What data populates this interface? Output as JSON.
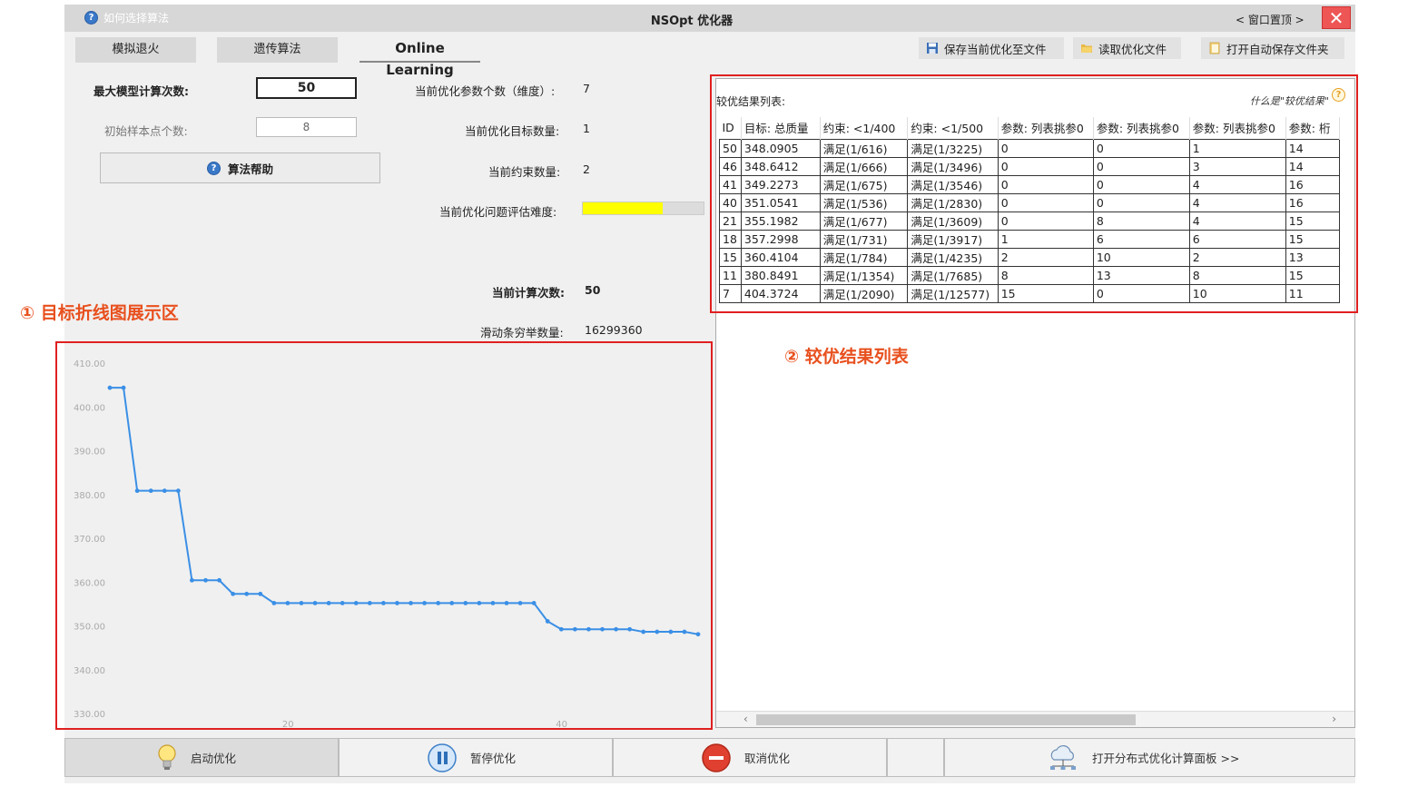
{
  "titlebar": {
    "help_label": "如何选择算法",
    "app_title": "NSOpt 优化器",
    "pin_label": "< 窗口置顶 >",
    "close_symbol": "✕"
  },
  "tabs": [
    {
      "label": "模拟退火"
    },
    {
      "label": "遗传算法"
    },
    {
      "label": "Online Learning"
    }
  ],
  "toolbar": {
    "save_label": "保存当前优化至文件",
    "load_label": "读取优化文件",
    "open_folder_label": "打开自动保存文件夹"
  },
  "settings": {
    "max_calc_label": "最大模型计算次数:",
    "max_calc_value": "50",
    "init_samples_label": "初始样本点个数:",
    "init_samples_value": "8",
    "algo_help_label": "算法帮助"
  },
  "status": {
    "param_count_label": "当前优化参数个数（维度）:",
    "param_count_value": "7",
    "objective_count_label": "当前优化目标数量:",
    "objective_count_value": "1",
    "constraint_count_label": "当前约束数量:",
    "constraint_count_value": "2",
    "difficulty_label": "当前优化问题评估难度:",
    "difficulty_level": 0.66,
    "difficulty_color": "#ffff00",
    "calc_count_label": "当前计算次数:",
    "calc_count_value": "50",
    "slider_enum_label": "滑动条穷举数量:",
    "slider_enum_value": "16299360"
  },
  "chart_data": {
    "type": "line",
    "title": "",
    "xlabel": "",
    "ylabel": "",
    "ylim": [
      330,
      410
    ],
    "yticks": [
      "410.00",
      "400.00",
      "390.00",
      "380.00",
      "370.00",
      "360.00",
      "350.00",
      "340.00",
      "330.00"
    ],
    "xticks": [
      "20",
      "40"
    ],
    "x_ticks_values": [
      20,
      40
    ],
    "x_range": [
      0,
      43
    ],
    "line_color": "#3a8fe6",
    "x": [
      7,
      8,
      9,
      10,
      11,
      12,
      13,
      14,
      15,
      16,
      17,
      18,
      19,
      20,
      21,
      22,
      23,
      24,
      25,
      26,
      27,
      28,
      29,
      30,
      31,
      32,
      33,
      34,
      35,
      36,
      37,
      38,
      39,
      40,
      41,
      42,
      43,
      44,
      45,
      46,
      47,
      48,
      49,
      50
    ],
    "values": [
      404.37,
      404.37,
      380.85,
      380.85,
      380.85,
      380.85,
      360.41,
      360.41,
      360.41,
      357.3,
      357.3,
      357.3,
      355.2,
      355.2,
      355.2,
      355.2,
      355.2,
      355.2,
      355.2,
      355.2,
      355.2,
      355.2,
      355.2,
      355.2,
      355.2,
      355.2,
      355.2,
      355.2,
      355.2,
      355.2,
      355.2,
      355.2,
      351.05,
      349.23,
      349.23,
      349.23,
      349.23,
      349.23,
      349.23,
      348.64,
      348.64,
      348.64,
      348.64,
      348.09
    ]
  },
  "results": {
    "title": "较优结果列表:",
    "what_is_label": "什么是\"较优结果\"",
    "columns": [
      "ID",
      "目标: 总质量",
      "约束: <1/400",
      "约束: <1/500",
      "参数: 列表挑参0",
      "参数: 列表挑参0",
      "参数: 列表挑参0",
      "参数: 桁"
    ],
    "rows": [
      [
        "50",
        "348.0905",
        "满足(1/616)",
        "满足(1/3225)",
        "0",
        "0",
        "1",
        "14"
      ],
      [
        "46",
        "348.6412",
        "满足(1/666)",
        "满足(1/3496)",
        "0",
        "0",
        "3",
        "14"
      ],
      [
        "41",
        "349.2273",
        "满足(1/675)",
        "满足(1/3546)",
        "0",
        "0",
        "4",
        "16"
      ],
      [
        "40",
        "351.0541",
        "满足(1/536)",
        "满足(1/2830)",
        "0",
        "0",
        "4",
        "16"
      ],
      [
        "21",
        "355.1982",
        "满足(1/677)",
        "满足(1/3609)",
        "0",
        "8",
        "4",
        "15"
      ],
      [
        "18",
        "357.2998",
        "满足(1/731)",
        "满足(1/3917)",
        "1",
        "6",
        "6",
        "15"
      ],
      [
        "15",
        "360.4104",
        "满足(1/784)",
        "满足(1/4235)",
        "2",
        "10",
        "2",
        "13"
      ],
      [
        "11",
        "380.8491",
        "满足(1/1354)",
        "满足(1/7685)",
        "8",
        "13",
        "8",
        "15"
      ],
      [
        "7",
        "404.3724",
        "满足(1/2090)",
        "满足(1/12577)",
        "15",
        "0",
        "10",
        "11"
      ]
    ]
  },
  "bottom": {
    "start_label": "启动优化",
    "pause_label": "暂停优化",
    "cancel_label": "取消优化",
    "distributed_label": "打开分布式优化计算面板 >>"
  },
  "annotations": {
    "chart_area": "① 目标折线图展示区",
    "results_area": "② 较优结果列表"
  }
}
